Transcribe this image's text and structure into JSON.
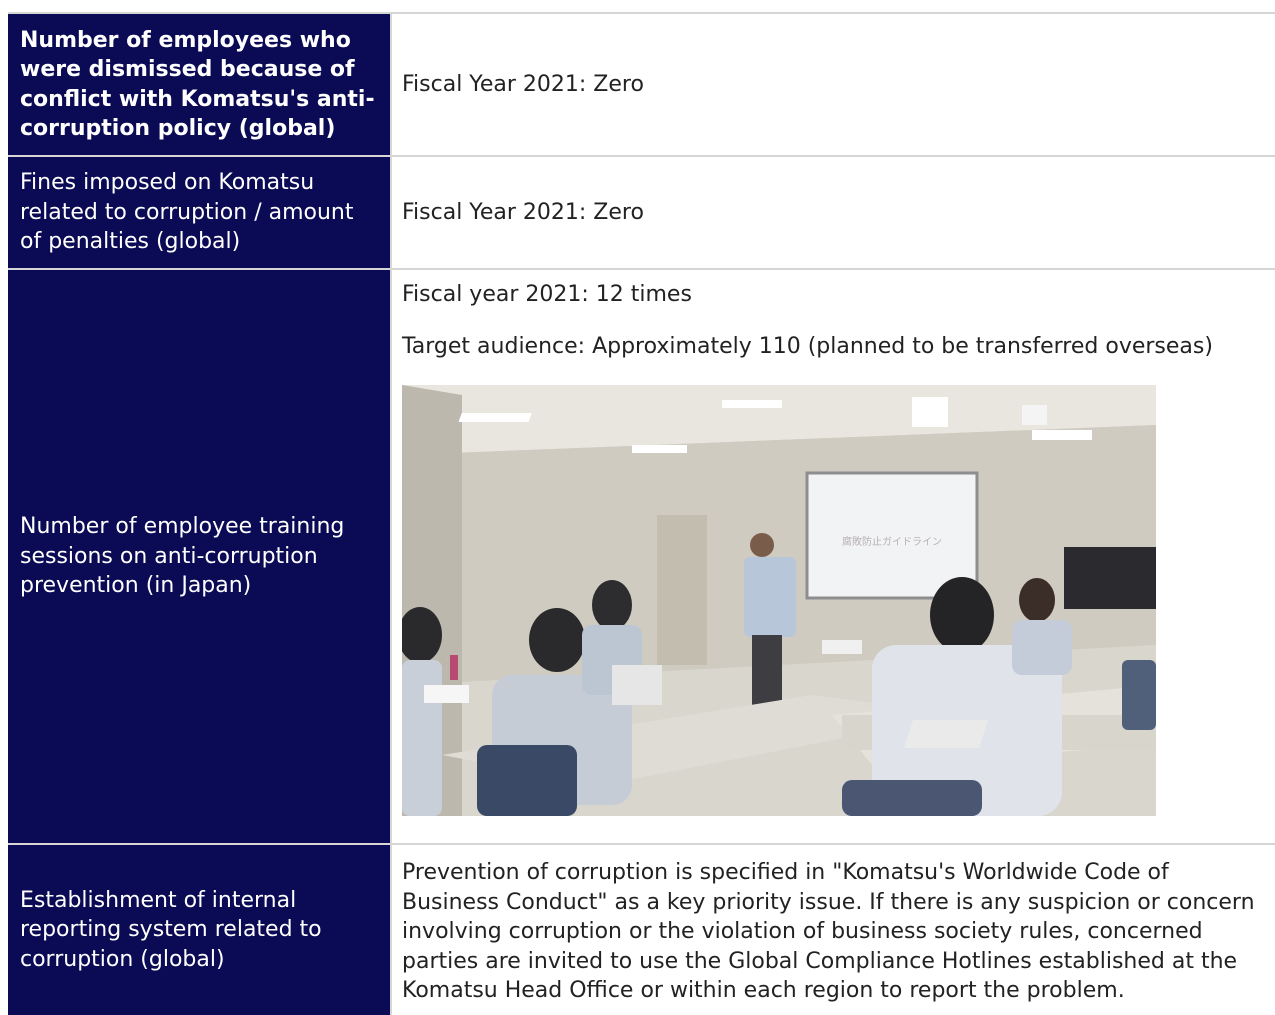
{
  "rows": [
    {
      "header": "Number of employees who were dismissed because of conflict with Komatsu's anti-corruption policy (global)",
      "value": "Fiscal Year 2021: Zero"
    },
    {
      "header": "Fines imposed on Komatsu related to corruption / amount of penalties (global)",
      "value": "Fiscal Year 2021: Zero"
    },
    {
      "header": "Number of employee training sessions on anti-corruption prevention (in Japan)",
      "value_line1": "Fiscal year 2021: 12 times",
      "value_line2": "Target audience: Approximately 110 (planned to be transferred overseas)",
      "photo_screen_text": "腐敗防止ガイドライン"
    },
    {
      "header": "Establishment of internal reporting system related to corruption (global)",
      "value": "Prevention of corruption is specified in \"Komatsu's Worldwide Code of Business Conduct\" as a key priority issue. If there is any suspicion or concern involving corruption or the violation of business society rules, concerned parties are invited to use the Global Compliance Hotlines established at the Komatsu Head Office or within each region to report the problem."
    }
  ],
  "colors": {
    "header_bg": "#0b0a55",
    "header_text": "#ffffff",
    "border": "#d6d6d6",
    "body_text": "#222222"
  }
}
